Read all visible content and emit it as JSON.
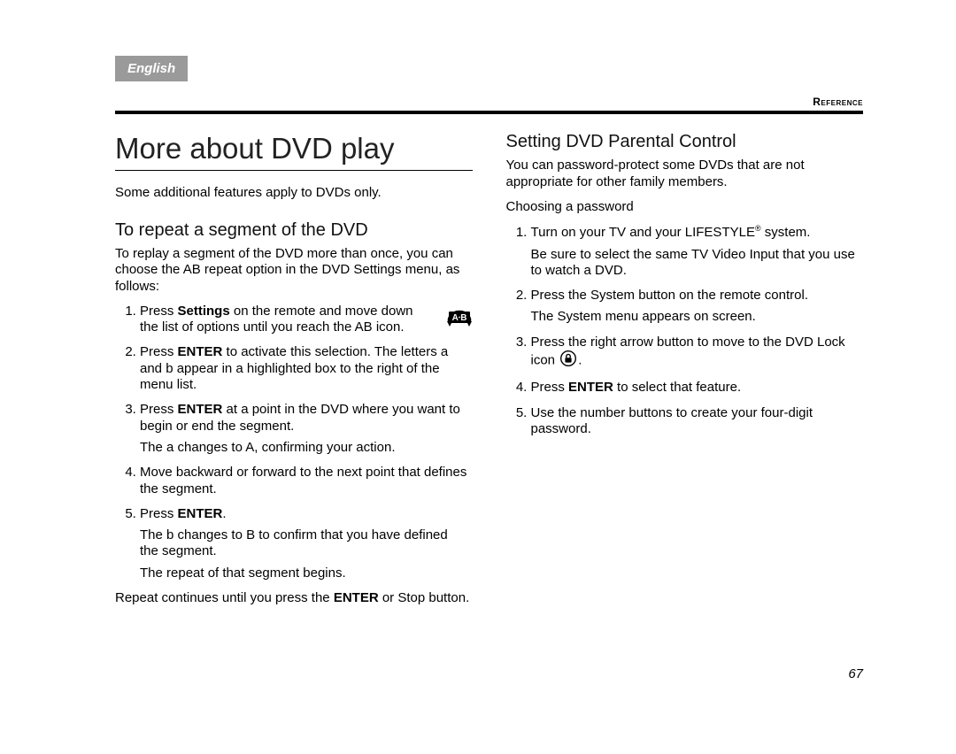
{
  "header": {
    "language": "English",
    "section": "Reference"
  },
  "page_number": "67",
  "left": {
    "title": "More about DVD play",
    "intro": "Some additional features apply to DVDs only.",
    "subheading": "To repeat a segment of the DVD",
    "subintro": "To replay a segment of the DVD more than once, you can choose the AB repeat option in the DVD Settings menu, as follows:",
    "step1_a": "Press ",
    "step1_bold": "Settings",
    "step1_b": " on the remote and move down the list of options until you reach the AB icon.",
    "step2_a": "Press ",
    "step2_bold": "ENTER",
    "step2_b": " to activate this selection. The letters a and b appear in a highlighted box to the right of the menu list.",
    "step3_a": "Press ",
    "step3_bold": "ENTER",
    "step3_b": " at a point in the DVD where you want to begin or end the segment.",
    "step3_sub": "The a changes to A, confirming your action.",
    "step4": "Move backward or forward to the next point that defines the segment.",
    "step5_a": "Press ",
    "step5_bold": "ENTER",
    "step5_b": ".",
    "step5_sub1": "The b changes to B to confirm that you have defined the segment.",
    "step5_sub2": "The repeat of that segment begins.",
    "footer_a": "Repeat continues until you press the ",
    "footer_bold": "ENTER",
    "footer_b": " or Stop button."
  },
  "right": {
    "heading": "Setting DVD Parental Control",
    "intro": "You can password-protect some DVDs that are not appropriate for other family members.",
    "choosing": "Choosing a password",
    "step1_a": "Turn on your TV and your LIFESTYLE",
    "step1_b": " system.",
    "step1_sub": "Be sure to select the same TV Video Input that you use to watch a DVD.",
    "step2": "Press the System button on the remote control.",
    "step2_sub": "The System menu appears on screen.",
    "step3_a": "Press the right arrow button to move to the DVD Lock icon ",
    "step3_b": ".",
    "step4_a": "Press ",
    "step4_bold": "ENTER",
    "step4_b": " to select that feature.",
    "step5": "Use the number buttons to create your four-digit password."
  },
  "icons": {
    "ab": "A·B",
    "lock": "lock"
  }
}
